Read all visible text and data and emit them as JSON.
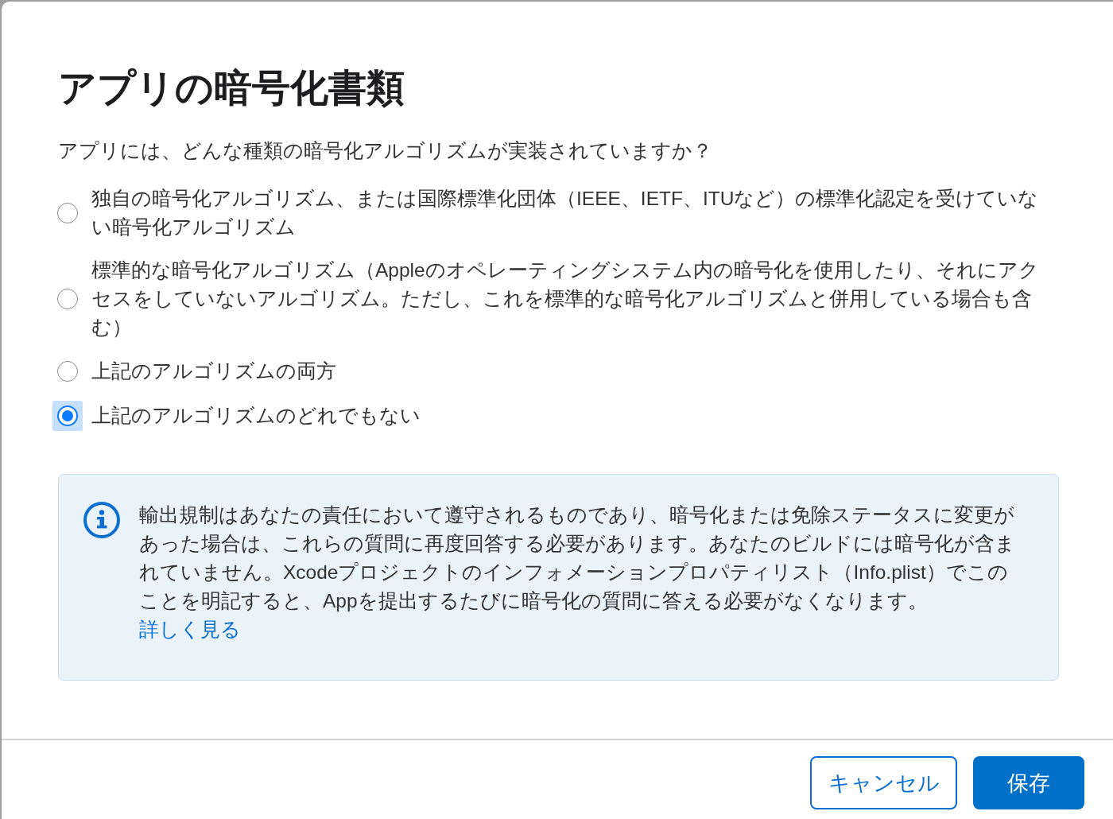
{
  "dialog": {
    "title": "アプリの暗号化書類",
    "question": "アプリには、どんな種類の暗号化アルゴリズムが実装されていますか？",
    "options": [
      {
        "label": "独自の暗号化アルゴリズム、または国際標準化団体（IEEE、IETF、ITUなど）の標準化認定を受けていない暗号化アルゴリズム",
        "selected": false
      },
      {
        "label": "標準的な暗号化アルゴリズム（Appleのオペレーティングシステム内の暗号化を使用したり、それにアクセスをしていないアルゴリズム。ただし、これを標準的な暗号化アルゴリズムと併用している場合も含む）",
        "selected": false
      },
      {
        "label": "上記のアルゴリズムの両方",
        "selected": false
      },
      {
        "label": "上記のアルゴリズムのどれでもない",
        "selected": true
      }
    ],
    "info": {
      "text": "輸出規制はあなたの責任において遵守されるものであり、暗号化または免除ステータスに変更があった場合は、これらの質問に再度回答する必要があります。あなたのビルドには暗号化が含まれていません。Xcodeプロジェクトのインフォメーションプロパティリスト（Info.plist）でこのことを明記すると、Appを提出するたびに暗号化の質問に答える必要がなくなります。",
      "link": "詳しく見る"
    },
    "buttons": [
      {
        "label": "キャンセル",
        "kind": "secondary"
      },
      {
        "label": "保存",
        "kind": "primary"
      }
    ]
  }
}
